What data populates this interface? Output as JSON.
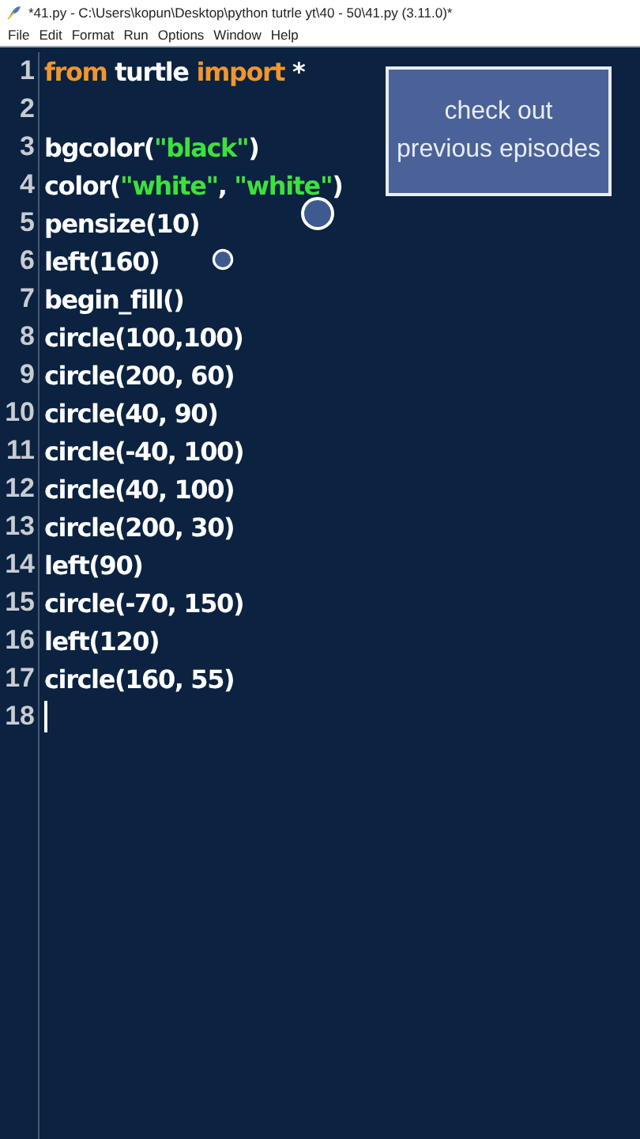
{
  "window": {
    "title": "*41.py - C:\\Users\\kopun\\Desktop\\python tutrle yt\\40 - 50\\41.py (3.11.0)*"
  },
  "menu": [
    "File",
    "Edit",
    "Format",
    "Run",
    "Options",
    "Window",
    "Help"
  ],
  "editor": {
    "lines": [
      {
        "number": "1",
        "cursor": false,
        "tokens": [
          {
            "kind": "keyword",
            "text": "from"
          },
          {
            "kind": "plain",
            "text": " turtle "
          },
          {
            "kind": "keyword",
            "text": "import"
          },
          {
            "kind": "plain",
            "text": " *"
          }
        ]
      },
      {
        "number": "2",
        "cursor": false
      },
      {
        "number": "3",
        "cursor": false,
        "tokens": [
          {
            "kind": "plain",
            "text": "bgcolor("
          },
          {
            "kind": "string",
            "text": "\"black\""
          },
          {
            "kind": "plain",
            "text": ")"
          }
        ]
      },
      {
        "number": "4",
        "cursor": false,
        "tokens": [
          {
            "kind": "plain",
            "text": "color("
          },
          {
            "kind": "string",
            "text": "\"white\""
          },
          {
            "kind": "plain",
            "text": ", "
          },
          {
            "kind": "string",
            "text": "\"white\""
          },
          {
            "kind": "plain",
            "text": ")"
          }
        ]
      },
      {
        "number": "5",
        "cursor": false,
        "tokens": [
          {
            "kind": "plain",
            "text": "pensize(10)"
          }
        ]
      },
      {
        "number": "6",
        "cursor": false,
        "tokens": [
          {
            "kind": "plain",
            "text": "left(160)"
          }
        ]
      },
      {
        "number": "7",
        "cursor": false,
        "tokens": [
          {
            "kind": "plain",
            "text": "begin_fill()"
          }
        ]
      },
      {
        "number": "8",
        "cursor": false,
        "tokens": [
          {
            "kind": "plain",
            "text": "circle(100,100)"
          }
        ]
      },
      {
        "number": "9",
        "cursor": false,
        "tokens": [
          {
            "kind": "plain",
            "text": "circle(200, 60)"
          }
        ]
      },
      {
        "number": "10",
        "cursor": false,
        "tokens": [
          {
            "kind": "plain",
            "text": "circle(40, 90)"
          }
        ]
      },
      {
        "number": "11",
        "cursor": false,
        "tokens": [
          {
            "kind": "plain",
            "text": "circle(-40, 100)"
          }
        ]
      },
      {
        "number": "12",
        "cursor": false,
        "tokens": [
          {
            "kind": "plain",
            "text": "circle(40, 100)"
          }
        ]
      },
      {
        "number": "13",
        "cursor": false,
        "tokens": [
          {
            "kind": "plain",
            "text": "circle(200, 30)"
          }
        ]
      },
      {
        "number": "14",
        "cursor": false,
        "tokens": [
          {
            "kind": "plain",
            "text": "left(90)"
          }
        ]
      },
      {
        "number": "15",
        "cursor": false,
        "tokens": [
          {
            "kind": "plain",
            "text": "circle(-70, 150)"
          }
        ]
      },
      {
        "number": "16",
        "cursor": false,
        "tokens": [
          {
            "kind": "plain",
            "text": "left(120)"
          }
        ]
      },
      {
        "number": "17",
        "cursor": false,
        "tokens": [
          {
            "kind": "plain",
            "text": "circle(160, 55)"
          }
        ]
      },
      {
        "number": "18",
        "cursor": true
      }
    ]
  },
  "overlay": {
    "caption": [
      "check out",
      "previous episodes"
    ]
  }
}
